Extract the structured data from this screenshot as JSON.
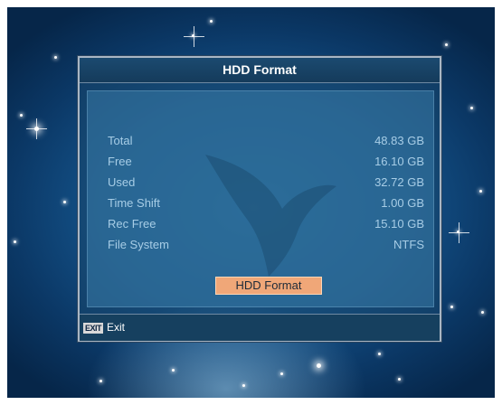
{
  "dialog": {
    "title": "HDD Format"
  },
  "hdd_info": [
    {
      "label": "Total",
      "value": "48.83 GB"
    },
    {
      "label": "Free",
      "value": "16.10 GB"
    },
    {
      "label": "Used",
      "value": "32.72 GB"
    },
    {
      "label": "Time Shift",
      "value": "1.00 GB"
    },
    {
      "label": "Rec Free",
      "value": "15.10 GB"
    },
    {
      "label": "File System",
      "value": "NTFS"
    }
  ],
  "format_button_label": "HDD Format",
  "footer": {
    "exit_key": "EXIT",
    "exit_label": "Exit"
  },
  "colors": {
    "label_text": "#a7cde6",
    "button_bg": "#f0a778",
    "background": "#14538a"
  }
}
